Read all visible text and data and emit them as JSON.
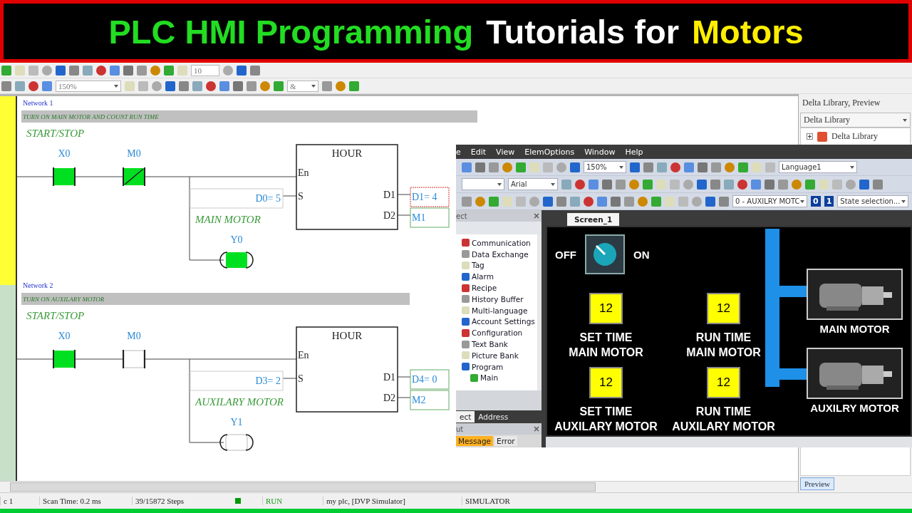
{
  "banner": {
    "parts": [
      {
        "text": "PLC HMI Programming",
        "color": "#22dd22"
      },
      {
        "text": "Tutorials for",
        "color": "#ffffff"
      },
      {
        "text": "Motors",
        "color": "#ffee00"
      }
    ]
  },
  "plc_toolbar": {
    "spin_value": "10",
    "zoom": "150%",
    "operator": "&"
  },
  "ladder": {
    "networks": [
      {
        "title": "Network 1",
        "comment": "TURN ON MAIN MOTOR AND COUNT RUN TIME",
        "selected": true,
        "label": "START/STOP",
        "contacts": [
          {
            "name": "X0",
            "on": true,
            "slashed": false
          },
          {
            "name": "M0",
            "on": true,
            "slashed": true
          }
        ],
        "block": {
          "name": "HOUR",
          "pins_left": [
            "En",
            "S"
          ],
          "pins_right": [
            "D1",
            "D2"
          ]
        },
        "input_value": "D0= 5",
        "outputs": [
          {
            "text": "D1= 4",
            "selected": true
          },
          {
            "text": "M1",
            "selected": false
          }
        ],
        "coil_label": "MAIN MOTOR",
        "coil": {
          "name": "Y0",
          "on": true
        }
      },
      {
        "title": "Network 2",
        "comment": "TURN ON AUXILARY MOTOR",
        "selected": false,
        "label": "START/STOP",
        "contacts": [
          {
            "name": "X0",
            "on": true,
            "slashed": false
          },
          {
            "name": "M0",
            "on": false,
            "slashed": false
          }
        ],
        "block": {
          "name": "HOUR",
          "pins_left": [
            "En",
            "S"
          ],
          "pins_right": [
            "D1",
            "D2"
          ]
        },
        "input_value": "D3= 2",
        "outputs": [
          {
            "text": "D4= 0",
            "selected": false
          },
          {
            "text": "M2",
            "selected": false
          }
        ],
        "coil_label": "AUXILARY MOTOR",
        "coil": {
          "name": "Y1",
          "on": false
        }
      }
    ]
  },
  "library": {
    "title": "Delta Library, Preview",
    "combo": "Delta Library",
    "tree": [
      {
        "label": "Delta Library",
        "expanded": false
      }
    ],
    "tab": "Preview"
  },
  "status_bar": [
    {
      "text": "c 1"
    },
    {
      "text": "Scan Time: 0.2 ms"
    },
    {
      "text": "39/15872 Steps"
    },
    {
      "text": "RUN",
      "kind": "run"
    },
    {
      "text": "my plc, [DVP Simulator]"
    },
    {
      "text": "SIMULATOR"
    }
  ],
  "hmi": {
    "menu": [
      "e",
      "Edit",
      "View",
      "ElemOptions",
      "Window",
      "Help"
    ],
    "zoom": "150%",
    "language": "Language1",
    "font": "Arial",
    "state_combo": "0 - AUXILRY MOTC",
    "state_buttons": [
      "0",
      "1"
    ],
    "state_selection": "State selection...",
    "project_panel": {
      "title": "ect",
      "tree": [
        {
          "label": "Communication"
        },
        {
          "label": "Data Exchange"
        },
        {
          "label": "Tag"
        },
        {
          "label": "Alarm"
        },
        {
          "label": "Recipe"
        },
        {
          "label": "History Buffer"
        },
        {
          "label": "Multi-language"
        },
        {
          "label": "Account Settings"
        },
        {
          "label": "Configuration"
        },
        {
          "label": "Text Bank"
        },
        {
          "label": "Picture Bank"
        },
        {
          "label": "Program",
          "children": [
            {
              "label": "Main"
            }
          ]
        }
      ],
      "tabs": [
        {
          "label": "ect",
          "selected": true
        },
        {
          "label": "Address",
          "selected": false
        }
      ]
    },
    "output_panel": {
      "title": "ut",
      "tabs": [
        {
          "label": "Message",
          "selected": true
        },
        {
          "label": "Error",
          "selected": false
        }
      ]
    },
    "screen_tab": "Screen_1",
    "screen": {
      "switch": {
        "off_label": "OFF",
        "on_label": "ON",
        "on": false
      },
      "displays": [
        {
          "value": "12",
          "lines": [
            "SET TIME",
            "MAIN MOTOR"
          ]
        },
        {
          "value": "12",
          "lines": [
            "RUN TIME",
            "MAIN MOTOR"
          ]
        },
        {
          "value": "12",
          "lines": [
            "SET TIME",
            "AUXILARY MOTOR"
          ]
        },
        {
          "value": "12",
          "lines": [
            "RUN TIME",
            "AUXILARY MOTOR"
          ]
        }
      ],
      "motors": [
        {
          "label": "MAIN MOTOR"
        },
        {
          "label": "AUXILRY MOTOR"
        }
      ]
    }
  }
}
